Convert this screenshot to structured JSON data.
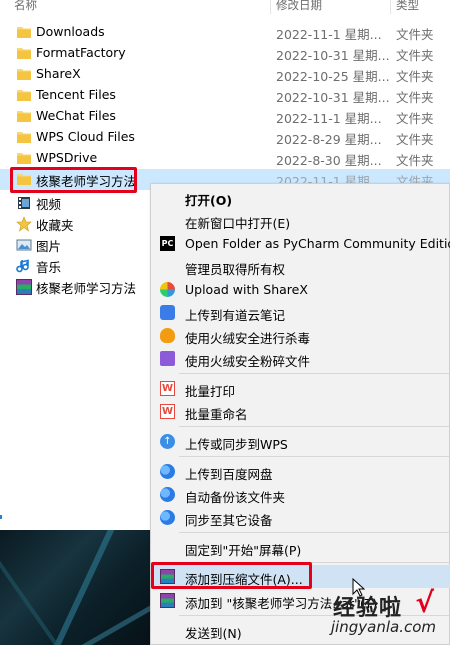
{
  "header": {
    "name": "名称",
    "modified": "修改日期",
    "type": "类型"
  },
  "rows": [
    {
      "name": "Downloads",
      "date": "2022-11-1 星期...",
      "type": "文件夹"
    },
    {
      "name": "FormatFactory",
      "date": "2022-10-31 星期...",
      "type": "文件夹"
    },
    {
      "name": "ShareX",
      "date": "2022-10-25 星期...",
      "type": "文件夹"
    },
    {
      "name": "Tencent Files",
      "date": "2022-10-31 星期...",
      "type": "文件夹"
    },
    {
      "name": "WeChat Files",
      "date": "2022-11-1 星期...",
      "type": "文件夹"
    },
    {
      "name": "WPS Cloud Files",
      "date": "2022-8-29 星期...",
      "type": "文件夹"
    },
    {
      "name": "WPSDrive",
      "date": "2022-8-30 星期...",
      "type": "文件夹"
    },
    {
      "name": "核聚老师学习方法",
      "date": "2022-11-1 星期...",
      "type": "文件夹"
    }
  ],
  "nav": [
    {
      "label": "视频",
      "icon": "video-icon"
    },
    {
      "label": "收藏夹",
      "icon": "star-icon"
    },
    {
      "label": "图片",
      "icon": "picture-icon"
    },
    {
      "label": "音乐",
      "icon": "music-icon"
    },
    {
      "label": "核聚老师学习方法",
      "icon": "rar-archive-icon"
    }
  ],
  "menu": {
    "open": "打开(O)",
    "open_new_window": "在新窗口中打开(E)",
    "pycharm": "Open Folder as PyCharm Community Edition Project",
    "take_ownership": "管理员取得所有权",
    "sharex": "Upload with ShareX",
    "youdao": "上传到有道云笔记",
    "huorong_scan": "使用火绒安全进行杀毒",
    "huorong_shred": "使用火绒安全粉碎文件",
    "batch_print": "批量打印",
    "batch_rename": "批量重命名",
    "wps_sync": "上传或同步到WPS",
    "baidu_upload": "上传到百度网盘",
    "baidu_backup": "自动备份该文件夹",
    "baidu_sync": "同步至其它设备",
    "pin_start": "固定到\"开始\"屏幕(P)",
    "add_archive": "添加到压缩文件(A)...",
    "add_to_named": "添加到 \"核聚老师学习方法.rar\"(T)",
    "send_to": "发送到(N)"
  },
  "watermark": {
    "text": "经验啦",
    "check": "√",
    "url": "jingyanla.com"
  },
  "colors": {
    "selection": "#cce8ff",
    "highlight_border": "#e3001b",
    "menu_bg": "#f2f2f2"
  }
}
